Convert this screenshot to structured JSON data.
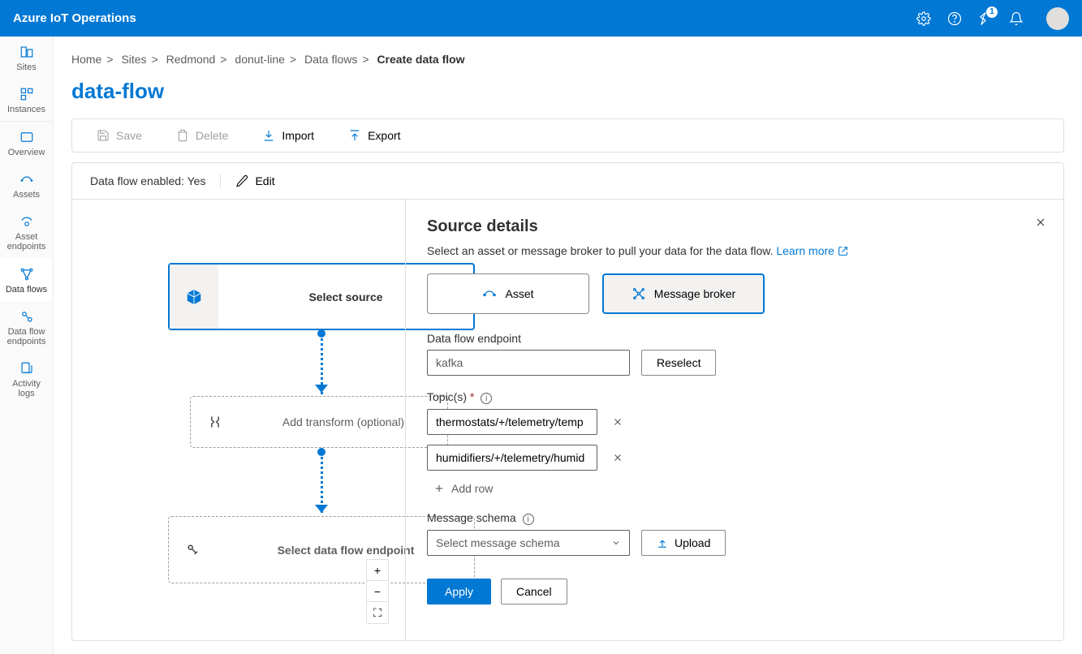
{
  "header": {
    "product": "Azure IoT Operations",
    "notification_badge": "1"
  },
  "sidenav": {
    "sites": "Sites",
    "instances": "Instances",
    "overview": "Overview",
    "assets": "Assets",
    "asset_endpoints": "Asset endpoints",
    "data_flows": "Data flows",
    "data_flow_endpoints": "Data flow endpoints",
    "activity_logs": "Activity logs"
  },
  "breadcrumbs": {
    "home": "Home",
    "sites": "Sites",
    "redmond": "Redmond",
    "donut": "donut-line",
    "dataflows": "Data flows",
    "current": "Create data flow"
  },
  "page_title": "data-flow",
  "toolbar": {
    "save": "Save",
    "delete": "Delete",
    "import": "Import",
    "export": "Export"
  },
  "enablebar": {
    "status_label": "Data flow enabled:",
    "status_value": "Yes",
    "edit": "Edit"
  },
  "canvas": {
    "source": "Select source",
    "transform": "Add transform (optional)",
    "dest": "Select data flow endpoint"
  },
  "panel": {
    "title": "Source details",
    "desc": "Select an asset or message broker to pull your data for the data flow.",
    "learn_more": "Learn more",
    "tab_asset": "Asset",
    "tab_broker": "Message broker",
    "endpoint_label": "Data flow endpoint",
    "endpoint_value": "kafka",
    "reselect": "Reselect",
    "topics_label": "Topic(s)",
    "topics": [
      "thermostats/+/telemetry/temp",
      "humidifiers/+/telemetry/humid"
    ],
    "add_row": "Add row",
    "schema_label": "Message schema",
    "schema_placeholder": "Select message schema",
    "upload": "Upload",
    "apply": "Apply",
    "cancel": "Cancel"
  }
}
